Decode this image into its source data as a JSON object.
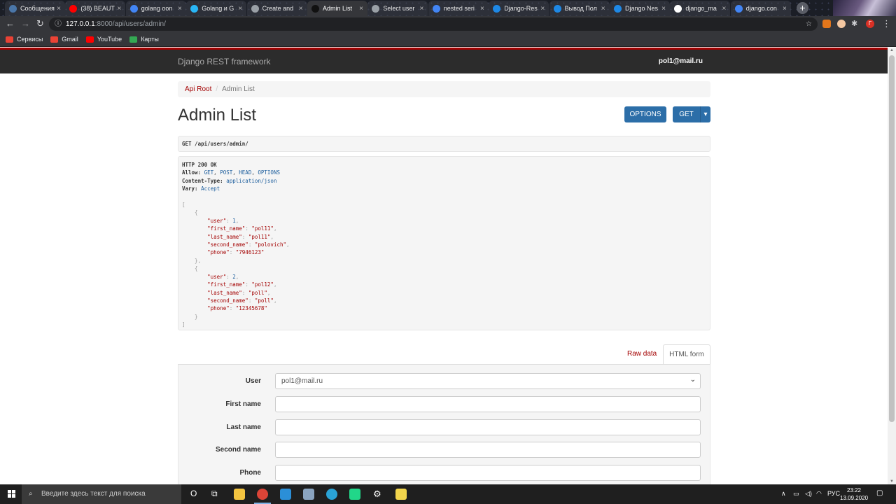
{
  "browser": {
    "tabs": [
      {
        "label": "Сообщения",
        "color": "#4a76a8"
      },
      {
        "label": "(38) BEAUT",
        "color": "#ff0000"
      },
      {
        "label": "golang oon",
        "color": "#4285f4"
      },
      {
        "label": "Golang и G",
        "color": "#29b6f6"
      },
      {
        "label": "Create and",
        "color": "#9aa0a6"
      },
      {
        "label": "Admin List",
        "color": "#111111"
      },
      {
        "label": "Select user",
        "color": "#9aa0a6"
      },
      {
        "label": "nested seri",
        "color": "#4285f4"
      },
      {
        "label": "Django-Res",
        "color": "#1e88e5"
      },
      {
        "label": "Вывод Пол",
        "color": "#1e88e5"
      },
      {
        "label": "Django Nes",
        "color": "#1e88e5"
      },
      {
        "label": "django_ma",
        "color": "#ffffff"
      },
      {
        "label": "django.con",
        "color": "#4285f4"
      }
    ],
    "url_host": "127.0.0.1",
    "url_path": ":8000/api/users/admin/",
    "bookmarks": [
      {
        "label": "Сервисы",
        "color": "#e94235"
      },
      {
        "label": "Gmail",
        "color": "#ea4335"
      },
      {
        "label": "YouTube",
        "color": "#ff0000"
      },
      {
        "label": "Карты",
        "color": "#34a853"
      }
    ],
    "new_tab": "+",
    "back": "←",
    "forward": "→",
    "reload": "↻",
    "star": "☆",
    "info": "ⓘ",
    "close": "×",
    "profile_initial": "Г",
    "menu": "⋮"
  },
  "drf": {
    "brand": "Django REST framework",
    "user": "pol1@mail.ru",
    "breadcrumb": {
      "root": "Api Root",
      "sep": "/",
      "current": "Admin List"
    },
    "title": "Admin List",
    "options_button": "OPTIONS",
    "get_button": "GET",
    "caret": "▾",
    "request": "GET /api/users/admin/",
    "response": {
      "status": "HTTP 200 OK",
      "allow_label": "Allow:",
      "allow_methods": [
        "GET",
        "POST",
        "HEAD",
        "OPTIONS"
      ],
      "content_type_label": "Content-Type:",
      "content_type": "application/json",
      "vary_label": "Vary:",
      "vary": "Accept",
      "records": [
        {
          "user": "1",
          "first_name": "\"pol11\"",
          "last_name": "\"pol11\"",
          "second_name": "\"polovich\"",
          "phone": "\"7946123\""
        },
        {
          "user": "2",
          "first_name": "\"pol12\"",
          "last_name": "\"poll\"",
          "second_name": "\"poll\"",
          "phone": "\"12345678\""
        }
      ]
    },
    "tab_raw": "Raw data",
    "tab_html": "HTML form",
    "form": {
      "user_label": "User",
      "user_value": "pol1@mail.ru",
      "first_name_label": "First name",
      "last_name_label": "Last name",
      "second_name_label": "Second name",
      "phone_label": "Phone"
    }
  },
  "taskbar": {
    "search_placeholder": "Введите здесь текст для поиска",
    "lang": "РУС",
    "time": "23:22",
    "date": "13.09.2020",
    "cortana": "O",
    "task_view": "⧉",
    "tray_up": "∧"
  }
}
